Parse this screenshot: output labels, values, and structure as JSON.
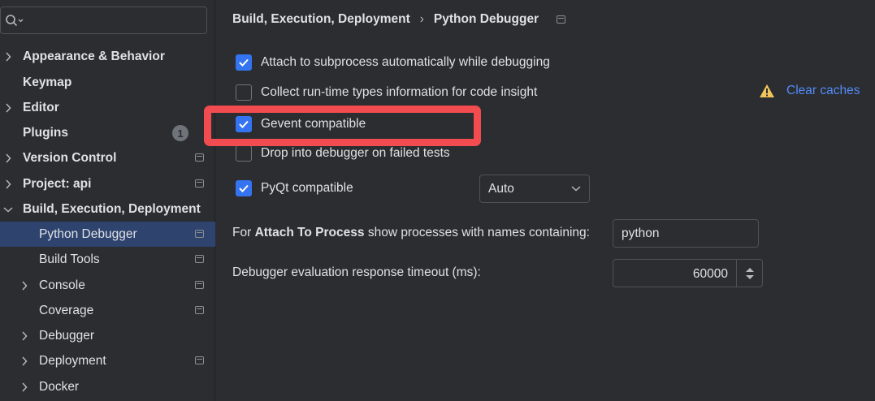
{
  "sidebar": {
    "items": [
      {
        "label": "Appearance & Behavior",
        "bold": true
      },
      {
        "label": "Keymap",
        "bold": true
      },
      {
        "label": "Editor",
        "bold": true
      },
      {
        "label": "Plugins",
        "bold": true,
        "badge": "1"
      },
      {
        "label": "Version Control",
        "bold": true
      },
      {
        "label": "Project: api",
        "bold": true
      },
      {
        "label": "Build, Execution, Deployment",
        "bold": true
      },
      {
        "label": "Python Debugger",
        "selected": true
      },
      {
        "label": "Build Tools"
      },
      {
        "label": "Console"
      },
      {
        "label": "Coverage"
      },
      {
        "label": "Debugger"
      },
      {
        "label": "Deployment"
      },
      {
        "label": "Docker"
      }
    ]
  },
  "breadcrumb": {
    "parent": "Build, Execution, Deployment",
    "current": "Python Debugger"
  },
  "options": {
    "attach_subprocess": {
      "label": "Attach to subprocess automatically while debugging",
      "checked": true
    },
    "collect_types": {
      "label": "Collect run-time types information for code insight",
      "checked": false
    },
    "gevent": {
      "label": "Gevent compatible",
      "checked": true
    },
    "drop_debugger": {
      "label": "Drop into debugger on failed tests",
      "checked": false
    },
    "pyqt": {
      "label": "PyQt compatible",
      "checked": true
    }
  },
  "clear_caches": "Clear caches",
  "pyqt_mode": {
    "selected": "Auto"
  },
  "attach_process": {
    "prefix": "For ",
    "bold": "Attach To Process",
    "suffix": " show processes with names containing:",
    "value": "python"
  },
  "timeout": {
    "label": "Debugger evaluation response timeout (ms):",
    "value": "60000"
  },
  "colors": {
    "accent": "#3574f0",
    "highlight_box": "#f24c50",
    "link": "#548af7",
    "warning": "#f2c55c"
  }
}
